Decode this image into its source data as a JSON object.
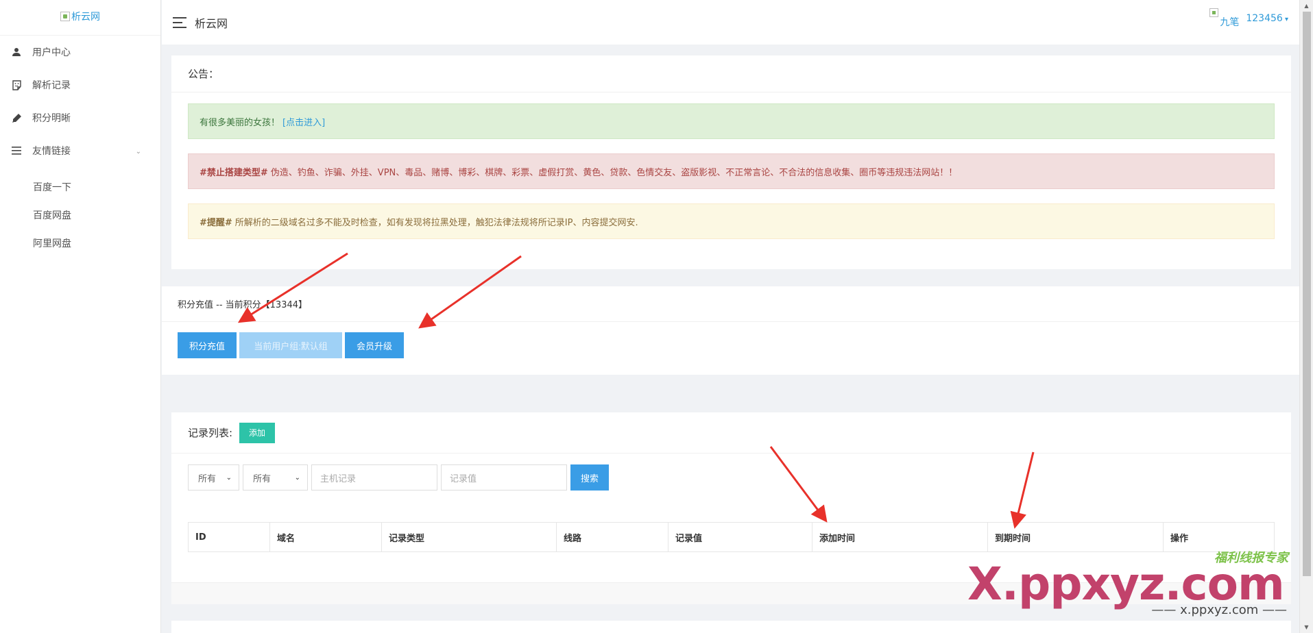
{
  "sidebar": {
    "logo_alt": "析云网",
    "items": [
      {
        "label": "用户中心",
        "icon": "user-icon"
      },
      {
        "label": "解析记录",
        "icon": "sticker-icon"
      },
      {
        "label": "积分明晰",
        "icon": "pencil-icon"
      },
      {
        "label": "友情链接",
        "icon": "list-icon"
      }
    ],
    "submenu": [
      "百度一下",
      "百度网盘",
      "阿里网盘"
    ]
  },
  "header": {
    "title": "析云网",
    "avatar_alt": "九笔",
    "username": "123456"
  },
  "notice": {
    "title": "公告：",
    "success_text": "有很多美丽的女孩！",
    "success_link": "[点击进入]",
    "danger_strong": "#禁止搭建类型#",
    "danger_text": "伪造、钓鱼、诈骗、外挂、VPN、毒品、赌博、博彩、棋牌、彩票、虚假打赏、黄色、贷款、色情交友、盗版影视、不正常言论、不合法的信息收集、圈币等违规违法网站！！",
    "warning_strong": "#提醒#",
    "warning_text": "所解析的二级域名过多不能及时检查，如有发现将拉黑处理，触犯法律法规将所记录IP、内容提交网安."
  },
  "points": {
    "title": "积分充值 -- 当前积分【13344】",
    "btn_recharge": "积分充值",
    "btn_group": "当前用户组:默认组",
    "btn_upgrade": "会员升级"
  },
  "records": {
    "title": "记录列表:",
    "add_label": "添加",
    "filter1": "所有",
    "filter2": "所有",
    "host_placeholder": "主机记录",
    "value_placeholder": "记录值",
    "search_label": "搜索",
    "columns": [
      "ID",
      "域名",
      "记录类型",
      "线路",
      "记录值",
      "添加时间",
      "到期时间",
      "操作"
    ]
  },
  "watermark": {
    "small": "福利线报专家",
    "big": "X.ppxyz.com",
    "url": "—— x.ppxyz.com ——"
  },
  "colors": {
    "primary": "#3a9de6",
    "teal": "#2dc3a8",
    "arrow": "#e8312a"
  }
}
